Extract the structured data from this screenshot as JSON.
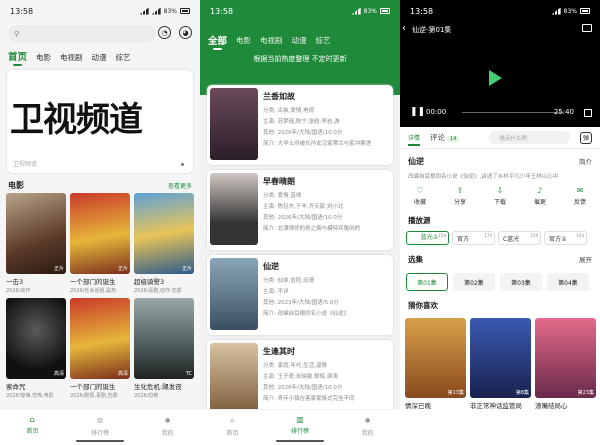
{
  "p1": {
    "status": {
      "time": "13:58",
      "battery": "83%"
    },
    "tabs": [
      "首页",
      "电影",
      "电视剧",
      "动漫",
      "综艺"
    ],
    "banner": {
      "title": "卫视频道",
      "sub": "卫视频道"
    },
    "section": {
      "title": "电影",
      "more": "查看更多"
    },
    "cards": [
      {
        "title": "一击3",
        "sub": "2026/动作",
        "badge": "正片"
      },
      {
        "title": "一个部门的诞生",
        "sub": "2026/社会话题,是热",
        "badge": "正片"
      },
      {
        "title": "超级骑警3",
        "sub": "2026/喜剧,动作,犯罪",
        "badge": "正片"
      },
      {
        "title": "索命咒",
        "sub": "2026/惊悚,恐怖,电影",
        "badge": "高清"
      },
      {
        "title": "一个部门的诞生",
        "sub": "2026/剧情,喜剧,犯罪",
        "badge": "高清"
      },
      {
        "title": "生化危机:飓发夜",
        "sub": "2026/恐怖",
        "badge": "TC"
      }
    ],
    "nav": [
      "首页",
      "排行榜",
      "我的"
    ]
  },
  "p2": {
    "status": {
      "time": "13:58",
      "battery": "83%"
    },
    "tabs": [
      "全部",
      "电影",
      "电视剧",
      "动漫",
      "综艺"
    ],
    "sub": "根据当前热度整理 不定时更新",
    "items": [
      {
        "title": "兰香如故",
        "type": "分类: 古装,爱情,电视",
        "cast": "主演: 苏梦瑶,陈宁,张晗,李岩,游",
        "meta": "其他: 2026年/大陆/国语/10.0分",
        "intro": "简介: 大学士府被长孙女汉家蒂兰与家冲寒遂"
      },
      {
        "title": "早春晴朗",
        "type": "分类: 爱情,音体",
        "cast": "主演: 陈钰杰,于羊,齐天宸,刘小北",
        "meta": "其他: 2026年/大陆/国语/10.0分",
        "intro": "简介: 北漂律师的青之烟与模特兵敬闲的"
      },
      {
        "title": "仙逆",
        "type": "分类: 仙侠,冒险,动漫",
        "cast": "主演: 不详",
        "meta": "其他: 2023年/大陆/国语/5.0分",
        "intro": "简介: 改编自耳根同名小说《仙逆》"
      },
      {
        "title": "生逢其时",
        "type": "分类: 家庭,年代,生活,温情",
        "cast": "主演: 王子奇,米晓敏,黎辉,谢涛",
        "meta": "其他: 2026年/大陆/国语/10.0分",
        "intro": "简介: 青年小镇在客家家族式完全不同"
      }
    ],
    "nav": [
      "首页",
      "排行榜",
      "我的"
    ]
  },
  "p3": {
    "status": {
      "time": "13:58",
      "battery": "83%"
    },
    "video": {
      "title": "仙逆-第01集",
      "cur": "00:00",
      "total": "25:40"
    },
    "tabs": {
      "detail": "详情",
      "comment": "评论",
      "count": "14",
      "placeholder": "说点什么吧"
    },
    "show": {
      "title": "仙逆",
      "intro_label": "简介",
      "desc": "改编自耳根同名小说《仙逆》,讲述了乡村平凡少年王林以心中"
    },
    "actions": [
      "收藏",
      "分享",
      "下载",
      "催更",
      "反馈"
    ],
    "source_label": "播放源",
    "sources": [
      {
        "n": "蓝光②",
        "c": "159"
      },
      {
        "n": "官方",
        "c": "174"
      },
      {
        "n": "C蓝光",
        "c": "159"
      },
      {
        "n": "官方②",
        "c": "164"
      }
    ],
    "ep_label": "选集",
    "ep_more": "展开",
    "eps": [
      "第01集",
      "第02集",
      "第03集",
      "第04集"
    ],
    "rec_label": "猜你喜欢",
    "recs": [
      {
        "t": "情深已晚",
        "b": "第13集"
      },
      {
        "t": "非正常神话监管局",
        "b": "第8集"
      },
      {
        "t": "渣嘴结局心",
        "b": "第23集"
      }
    ]
  }
}
